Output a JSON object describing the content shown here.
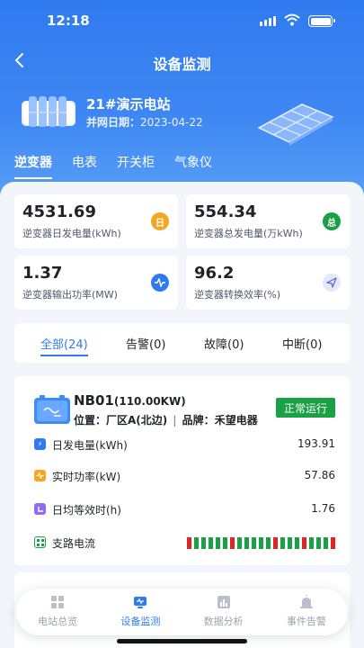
{
  "status_bar": {
    "time": "12:18"
  },
  "header": {
    "title": "设备监测"
  },
  "station": {
    "name": "21#演示电站",
    "date_label": "并网日期：",
    "date": "2023-04-22"
  },
  "tabs": [
    "逆变器",
    "电表",
    "开关柜",
    "气象仪"
  ],
  "kpis": [
    {
      "value": "4531.69",
      "label": "逆变器日发电量(kWh)",
      "badge": "日",
      "color": "#f5a623"
    },
    {
      "value": "554.34",
      "label": "逆变器总发电量(万kWh)",
      "badge": "总",
      "color": "#1aa045"
    },
    {
      "value": "1.37",
      "label": "逆变器输出功率(MW)",
      "badge": "",
      "color": "#2f7af0"
    },
    {
      "value": "96.2",
      "label": "逆变器转换效率(%)",
      "badge": "",
      "color": "#e6e8fb"
    }
  ],
  "filters": [
    "全部(24)",
    "告警(0)",
    "故障(0)",
    "中断(0)"
  ],
  "device": {
    "name": "NB01",
    "capacity": "(110.00KW)",
    "location_label": "位置：",
    "location": "厂区A(北边)",
    "brand_label": "品牌：",
    "brand": "禾望电器",
    "status": "正常运行",
    "rows": [
      {
        "label": "日发电量(kWh)",
        "value": "193.91",
        "color": "#2f7af0",
        "icon": "lightning-icon"
      },
      {
        "label": "实时功率(kW)",
        "value": "57.86",
        "color": "#f5a623",
        "icon": "pulse-icon"
      },
      {
        "label": "日均等效时(h)",
        "value": "1.76",
        "color": "#8e6cf0",
        "icon": "clock-icon"
      },
      {
        "label": "支路电流",
        "value": "",
        "color": "#1aa045",
        "icon": "grid-icon"
      }
    ],
    "branch_currents": [
      "red",
      "green",
      "green",
      "green",
      "green",
      "green",
      "red",
      "green",
      "green",
      "green",
      "green",
      "green",
      "red",
      "green",
      "green",
      "green",
      "red",
      "green",
      "green",
      "green",
      "red"
    ]
  },
  "nav": [
    "电站总览",
    "设备监测",
    "数据分析",
    "事件告警"
  ]
}
